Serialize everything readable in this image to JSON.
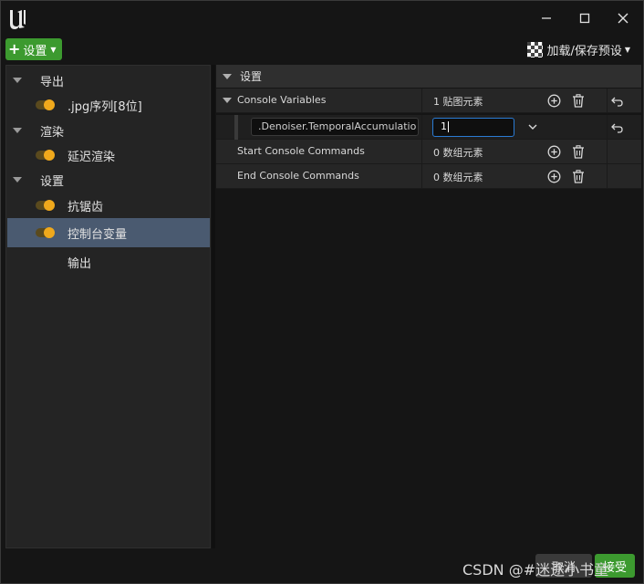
{
  "window": {
    "minimize_icon": "minimize-icon",
    "maximize_icon": "maximize-icon",
    "close_icon": "close-icon",
    "logo": "unreal-logo"
  },
  "toolbar": {
    "settings_label": "设置",
    "preset_label": "加载/保存预设"
  },
  "left_tree": {
    "items": [
      {
        "label": "导出",
        "type": "category"
      },
      {
        "label": ".jpg序列[8位]",
        "type": "setting",
        "enabled": true
      },
      {
        "label": "渲染",
        "type": "category"
      },
      {
        "label": "延迟渲染",
        "type": "setting",
        "enabled": true
      },
      {
        "label": "设置",
        "type": "category"
      },
      {
        "label": "抗锯齿",
        "type": "setting",
        "enabled": true
      },
      {
        "label": "控制台变量",
        "type": "setting",
        "enabled": true,
        "selected": true
      },
      {
        "label": "输出",
        "type": "setting"
      }
    ]
  },
  "details": {
    "section_title": "设置",
    "console_variables": {
      "name": "Console Variables",
      "value": "1 贴图元素"
    },
    "cvar_entry": {
      "key": ".Denoiser.TemporalAccumulatio",
      "value": "1"
    },
    "start_commands": {
      "name": "Start Console Commands",
      "value": "0 数组元素"
    },
    "end_commands": {
      "name": "End Console Commands",
      "value": "0 数组元素"
    }
  },
  "footer": {
    "watermark": "CSDN @#迷途小书童",
    "cancel_label": "取消",
    "accept_label": "接受"
  },
  "colors": {
    "accent_green": "#3c9a2f",
    "toggle_on": "#f0a91c",
    "selected_row": "#4a5a70",
    "focus_border": "#2a7bd4"
  }
}
